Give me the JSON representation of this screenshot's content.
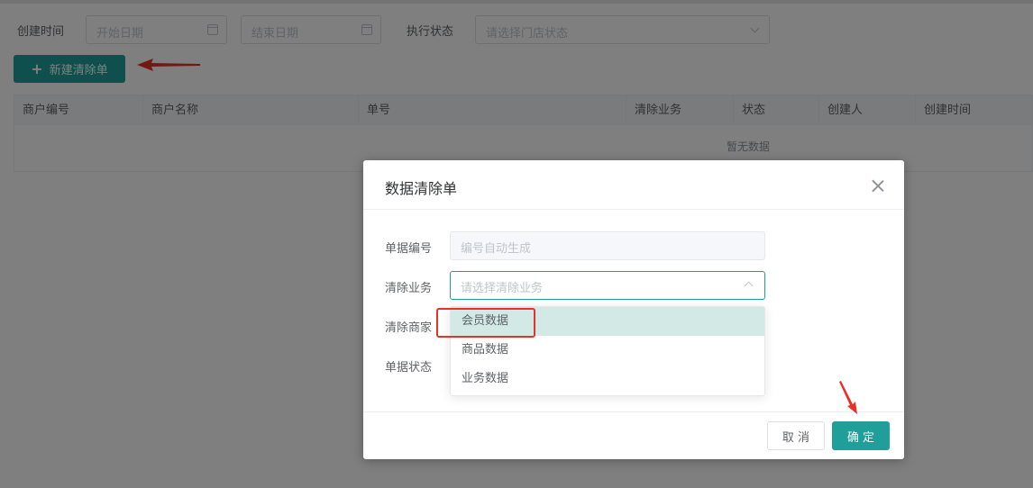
{
  "filters": {
    "created_time_label": "创建时间",
    "start_date_placeholder": "开始日期",
    "end_date_placeholder": "结束日期",
    "exec_status_label": "执行状态",
    "status_placeholder": "请选择门店状态"
  },
  "toolbar": {
    "new_button_label": "新建清除单",
    "new_button_icon": "plus-icon"
  },
  "table": {
    "columns": [
      "商户编号",
      "商户名称",
      "单号",
      "清除业务",
      "状态",
      "创建人",
      "创建时间"
    ],
    "empty_text": "暂无数据"
  },
  "dialog": {
    "title": "数据清除单",
    "close_icon": "close-icon",
    "fields": {
      "doc_no_label": "单据编号",
      "doc_no_placeholder": "编号自动生成",
      "clear_business_label": "清除业务",
      "clear_business_placeholder": "请选择清除业务",
      "clear_merchant_label": "清除商家",
      "doc_status_label": "单据状态"
    },
    "dropdown_options": [
      "会员数据",
      "商品数据",
      "业务数据"
    ],
    "selected_option": "会员数据",
    "cancel_label": "取 消",
    "confirm_label": "确 定"
  },
  "colors": {
    "primary": "#1f9e9a",
    "annotation": "#e6332a",
    "selected_option_bg": "#d2e9e6"
  }
}
